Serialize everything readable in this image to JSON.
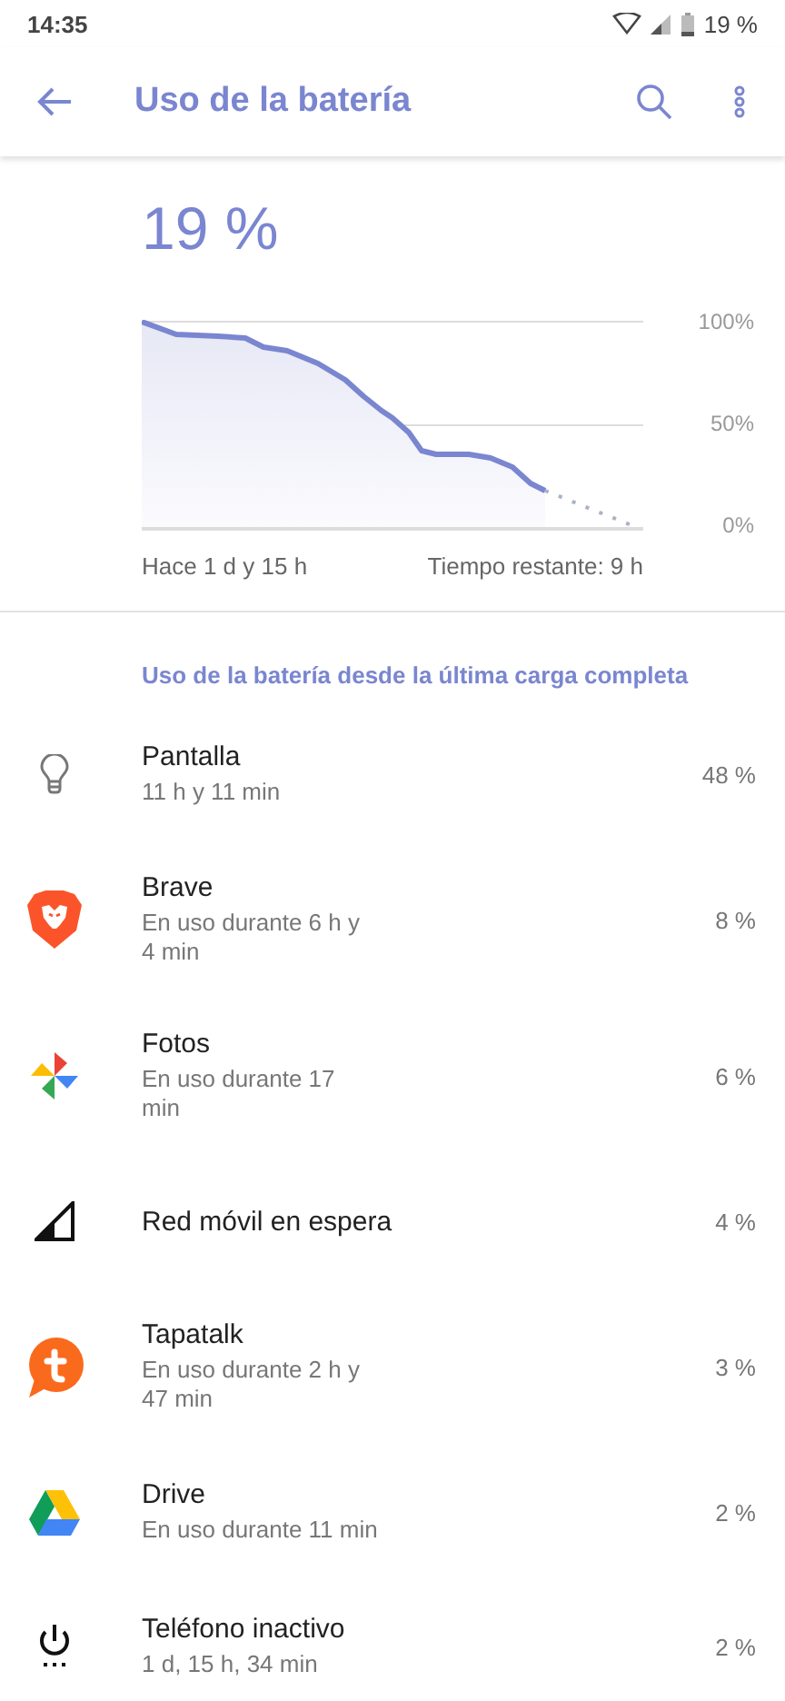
{
  "status_bar": {
    "time": "14:35",
    "battery": "19 %"
  },
  "app_bar": {
    "title": "Uso de la batería"
  },
  "summary": {
    "level_text": "19 %",
    "y_labels": [
      "100%",
      "50%",
      "0%"
    ],
    "start_label": "Hace 1 d y 15 h",
    "remaining_label": "Tiempo restante: 9 h"
  },
  "section": {
    "title": "Uso de la batería desde la última carga completa"
  },
  "items": [
    {
      "kind": "bulb",
      "name": "Pantalla",
      "detail": "11 h y 11 min",
      "percent": "48 %"
    },
    {
      "kind": "lion",
      "name": "Brave",
      "detail": "En uso durante 6 h y\n4 min",
      "percent": "8 %"
    },
    {
      "kind": "pinwheel",
      "name": "Fotos",
      "detail": "En uso durante 17\nmin",
      "percent": "6 %"
    },
    {
      "kind": "signal",
      "name": "Red móvil en espera",
      "percent": "4 %"
    },
    {
      "kind": "bubble",
      "name": "Tapatalk",
      "detail": "En uso durante 2 h y\n47 min",
      "percent": "3 %"
    },
    {
      "kind": "triangle",
      "name": "Drive",
      "detail": "En uso durante 11 min",
      "percent": "2 %"
    },
    {
      "kind": "power",
      "name": "Teléfono inactivo",
      "detail": "1 d, 15 h, 34 min",
      "percent": "2 %"
    }
  ]
}
